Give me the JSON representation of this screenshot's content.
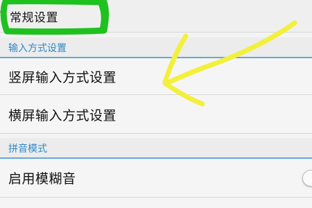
{
  "header": {
    "title": "常规设置",
    "back_icon": "chevron-left-icon"
  },
  "sections": [
    {
      "title": "输入方式设置",
      "items": [
        {
          "label": "竖屏输入方式设置"
        },
        {
          "label": "横屏输入方式设置"
        }
      ]
    },
    {
      "title": "拼音模式",
      "items": [
        {
          "label": "启用模糊音",
          "toggle": "off"
        }
      ]
    }
  ],
  "colors": {
    "section_accent": "#2f88c8",
    "highlight_marker": "#1fc11f",
    "arrow_marker": "#f2f03c"
  }
}
